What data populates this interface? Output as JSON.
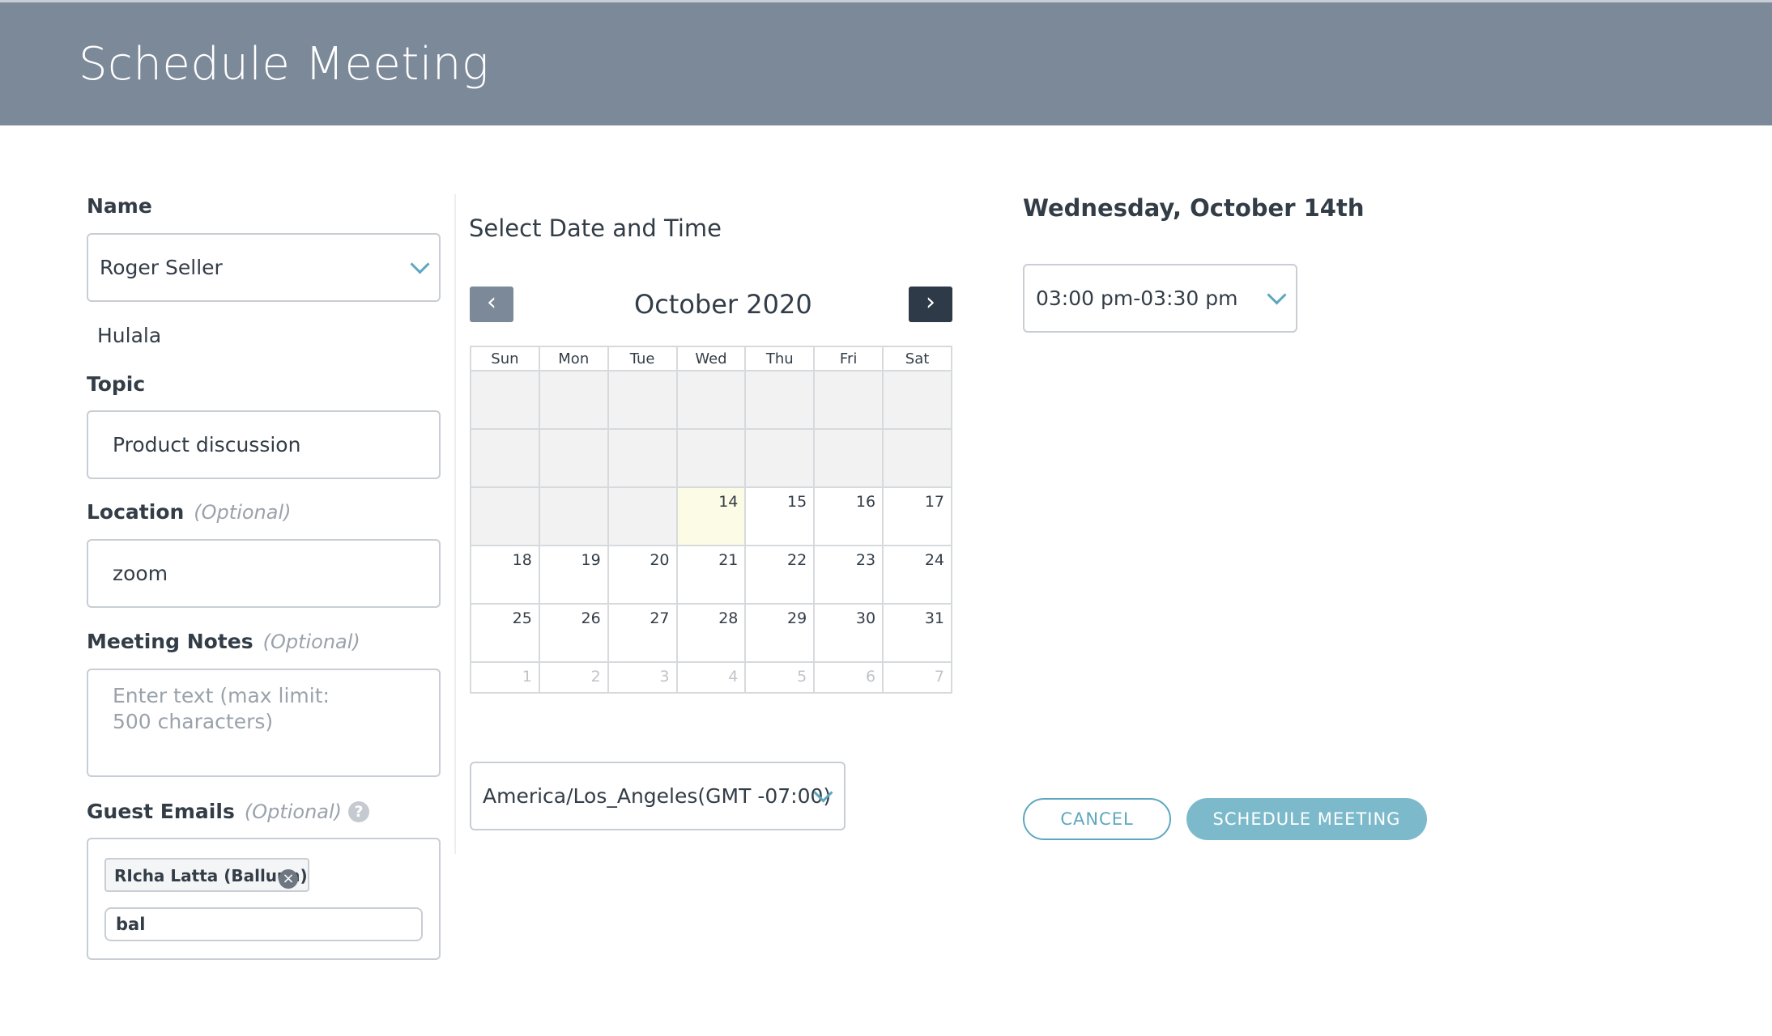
{
  "header": {
    "title": "Schedule Meeting"
  },
  "form": {
    "name": {
      "label": "Name",
      "value": "Roger Seller",
      "company": "Hulala"
    },
    "topic": {
      "label": "Topic",
      "value": "Product discussion"
    },
    "location": {
      "label": "Location",
      "optional": "(Optional)",
      "value": "zoom"
    },
    "notes": {
      "label": "Meeting Notes",
      "optional": "(Optional)",
      "placeholder": "Enter text (max limit: 500 characters)"
    },
    "guests": {
      "label": "Guest Emails",
      "optional": "(Optional)",
      "help": "?",
      "chips": [
        {
          "label": "RIcha Latta (Balluun)",
          "remove": "×"
        }
      ],
      "input_value": "bal"
    }
  },
  "calendar": {
    "section_title": "Select Date and Time",
    "month_title": "October 2020",
    "prev": "‹",
    "next": "›",
    "weekdays": [
      "Sun",
      "Mon",
      "Tue",
      "Wed",
      "Thu",
      "Fri",
      "Sat"
    ],
    "weeks": [
      [
        "",
        "",
        "",
        "",
        "",
        "",
        ""
      ],
      [
        "",
        "",
        "",
        "",
        "",
        "",
        ""
      ],
      [
        "",
        "",
        "",
        "14",
        "15",
        "16",
        "17"
      ],
      [
        "18",
        "19",
        "20",
        "21",
        "22",
        "23",
        "24"
      ],
      [
        "25",
        "26",
        "27",
        "28",
        "29",
        "30",
        "31"
      ],
      [
        "1",
        "2",
        "3",
        "4",
        "5",
        "6",
        "7"
      ]
    ],
    "selected_day": "14",
    "timezone": "America/Los_Angeles(GMT -07:00)"
  },
  "time": {
    "date_heading": "Wednesday, October 14th",
    "slot": "03:00 pm-03:30 pm"
  },
  "actions": {
    "cancel": "CANCEL",
    "schedule": "SCHEDULE MEETING"
  },
  "colors": {
    "header_bg": "#7c8999",
    "accent": "#5ea7bf",
    "schedule_btn": "#7cbacb",
    "nav_prev": "#7c8999",
    "nav_next": "#2e3a48"
  }
}
